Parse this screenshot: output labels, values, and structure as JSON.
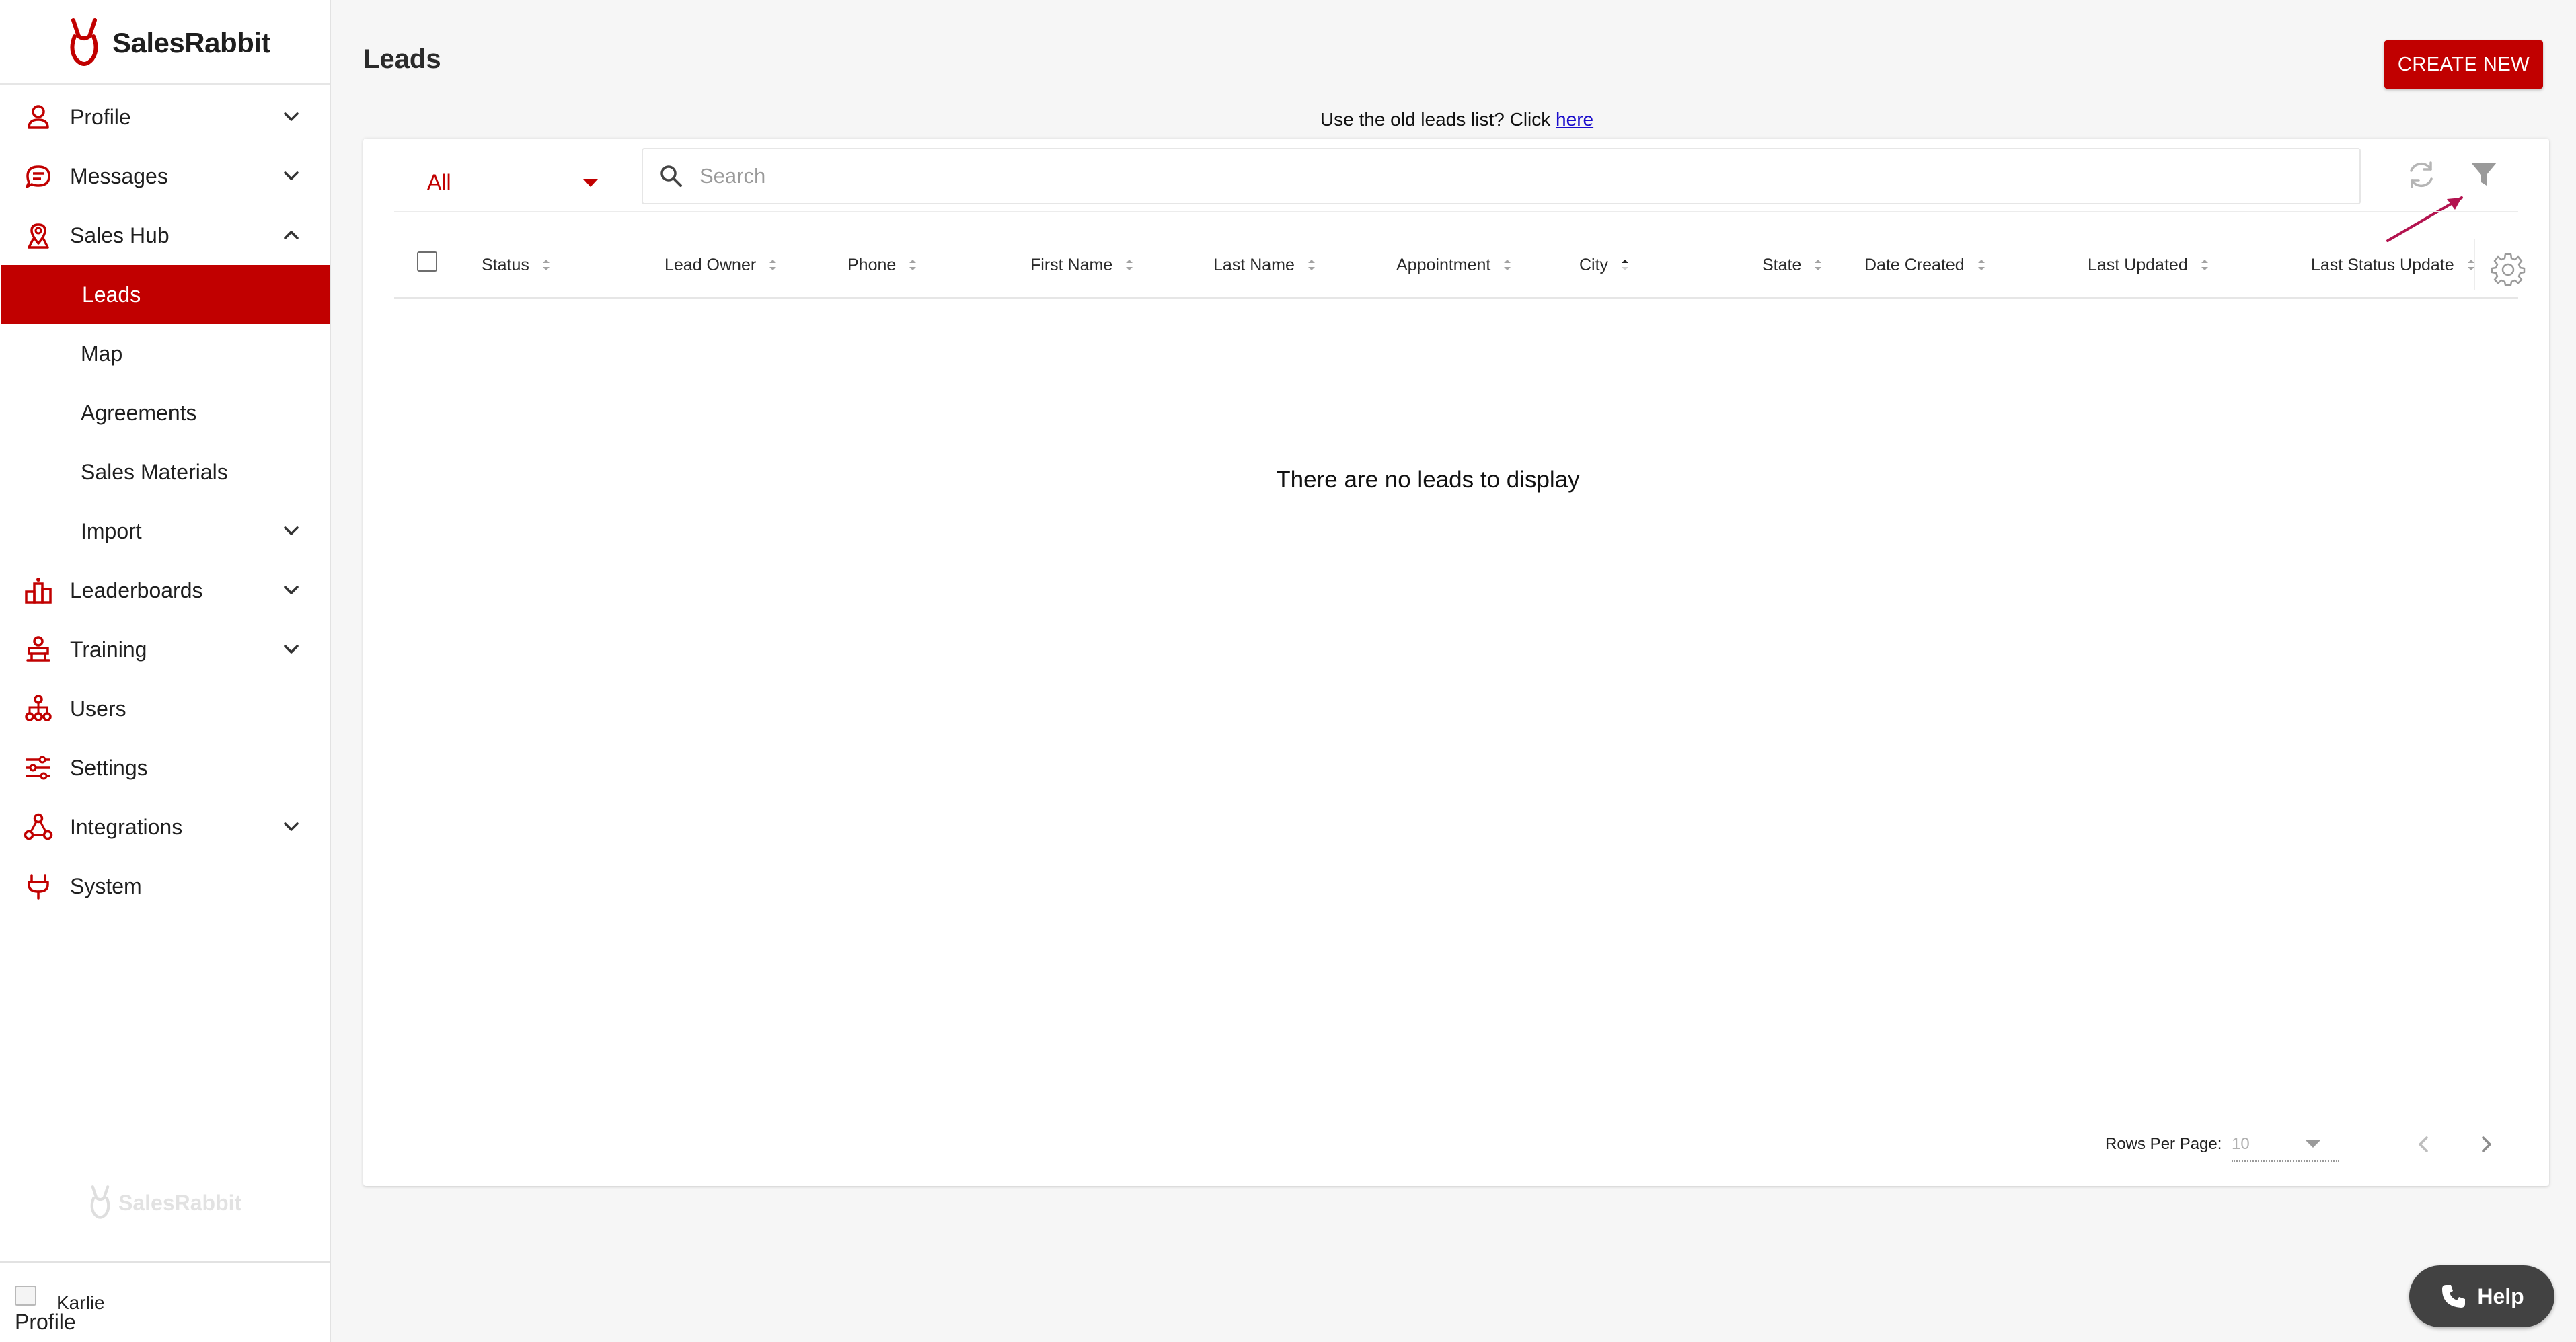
{
  "brand": {
    "name": "SalesRabbit",
    "accent": "#c10000"
  },
  "sidebar": {
    "items": [
      {
        "label": "Profile",
        "icon": "person-icon"
      },
      {
        "label": "Messages",
        "icon": "chat-icon"
      },
      {
        "label": "Sales Hub",
        "icon": "map-pin-icon"
      },
      {
        "label": "Leads"
      },
      {
        "label": "Map"
      },
      {
        "label": "Agreements"
      },
      {
        "label": "Sales Materials"
      },
      {
        "label": "Import"
      },
      {
        "label": "Leaderboards",
        "icon": "podium-icon"
      },
      {
        "label": "Training",
        "icon": "training-icon"
      },
      {
        "label": "Users",
        "icon": "org-chart-icon"
      },
      {
        "label": "Settings",
        "icon": "sliders-icon"
      },
      {
        "label": "Integrations",
        "icon": "integrations-icon"
      },
      {
        "label": "System",
        "icon": "plug-icon"
      }
    ],
    "user": {
      "name": "Karlie",
      "image_alt": "Profile"
    }
  },
  "header": {
    "title": "Leads",
    "create_label": "CREATE NEW",
    "old_list_text": "Use the old leads list? Click",
    "old_list_link": "here"
  },
  "toolbar": {
    "filter_value": "All",
    "search_placeholder": "Search"
  },
  "table": {
    "columns": [
      "Status",
      "Lead Owner",
      "Phone",
      "First Name",
      "Last Name",
      "Appointment",
      "City",
      "State",
      "Date Created",
      "Last Updated",
      "Last Status Update"
    ],
    "sorted_column": "City",
    "empty_message": "There are no leads to display"
  },
  "pagination": {
    "rows_label": "Rows Per Page:",
    "rows_value": "10"
  },
  "help": {
    "label": "Help"
  }
}
